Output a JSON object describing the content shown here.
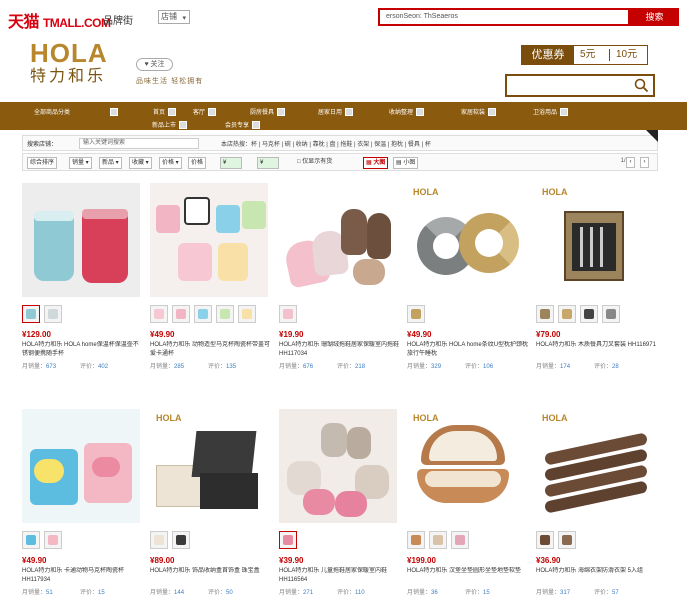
{
  "topbar": {
    "logo": "天猫",
    "logo_sub": "TMALL.COM",
    "site_label": "品牌街",
    "site_select": "店铺",
    "search_value": "ersonSeon: ThSeaeros",
    "search_button": "搜索"
  },
  "brand": {
    "logo_word": "HOLA",
    "logo_cn": "特力和乐",
    "fav_label": "♥ 关注",
    "slogan": "品味生活 轻松拥有"
  },
  "coupon": {
    "label": "优惠券",
    "option1": "5元",
    "option2": "10元"
  },
  "nav": {
    "items": [
      "全部商品分类",
      "首页",
      "客厅",
      "厨房餐具",
      "居家日用",
      "收纳整理",
      "家居软装",
      "卫浴用品",
      "新品上市",
      "会员专享"
    ]
  },
  "filter1": {
    "label": "搜索店铺：",
    "placeholder": "输入关键词搜索",
    "tags": "本店热搜：杯 | 马克杯 | 碗 | 收纳 | 靠枕 | 盘 | 拖鞋 | 衣架 | 保温 | 抱枕 | 餐具 | 杯"
  },
  "filter2": {
    "sort_default": "综合排序",
    "sort_sales": "销量 ▾",
    "sort_new": "新品 ▾",
    "sort_review": "收藏 ▾",
    "sort_price": "价格 ▾",
    "price_label": "价格",
    "price_from": "¥",
    "price_to": "¥",
    "only_stock": "□ 仅显示有货",
    "view_large": "▦ 大图",
    "view_small": "▤ 小图",
    "pager_text": "1/8",
    "prev": "‹",
    "next": "›"
  },
  "products": [
    {
      "price": "¥129.00",
      "title": "HOLA特力和乐 HOLA home保温杯保温壶不锈钢便携随手杯",
      "sales_label": "月销量：",
      "sales": "673",
      "reviews_label": "评价：",
      "reviews": "402"
    },
    {
      "price": "¥49.90",
      "title": "HOLA特力和乐 动物造型马克杯陶瓷杯带盖可爱卡通杯",
      "sales_label": "月销量：",
      "sales": "285",
      "reviews_label": "评价：",
      "reviews": "135"
    },
    {
      "price": "¥19.90",
      "title": "HOLA特力和乐 珊瑚绒拖鞋居家保暖室内拖鞋 HH117034",
      "sales_label": "月销量：",
      "sales": "676",
      "reviews_label": "评价：",
      "reviews": "218"
    },
    {
      "price": "¥49.90",
      "title": "HOLA特力和乐 HOLA home条纹U型枕护颈枕旅行午睡枕",
      "sales_label": "月销量：",
      "sales": "329",
      "reviews_label": "评价：",
      "reviews": "106"
    },
    {
      "price": "¥79.00",
      "title": "HOLA特力和乐 木质餐具刀叉套装 HH116971",
      "sales_label": "月销量：",
      "sales": "174",
      "reviews_label": "评价：",
      "reviews": "28"
    },
    {
      "price": "¥49.90",
      "title": "HOLA特力和乐 卡通动物马克杯陶瓷杯 HH117934",
      "sales_label": "月销量：",
      "sales": "51",
      "reviews_label": "评价：",
      "reviews": "15"
    },
    {
      "price": "¥89.00",
      "title": "HOLA特力和乐 饰品收纳盒首饰盒 珠宝盒",
      "sales_label": "月销量：",
      "sales": "144",
      "reviews_label": "评价：",
      "reviews": "50"
    },
    {
      "price": "¥39.90",
      "title": "HOLA特力和乐 儿童拖鞋居家保暖室内鞋 HH116564",
      "sales_label": "月销量：",
      "sales": "271",
      "reviews_label": "评价：",
      "reviews": "110"
    },
    {
      "price": "¥199.00",
      "title": "HOLA特力和乐 汉堡坐垫圆形坐垫地垫软垫",
      "sales_label": "月销量：",
      "sales": "36",
      "reviews_label": "评价：",
      "reviews": "15"
    },
    {
      "price": "¥36.90",
      "title": "HOLA特力和乐 海绵衣架防滑衣架 5入组",
      "sales_label": "月销量：",
      "sales": "317",
      "reviews_label": "评价：",
      "reviews": "57"
    }
  ]
}
